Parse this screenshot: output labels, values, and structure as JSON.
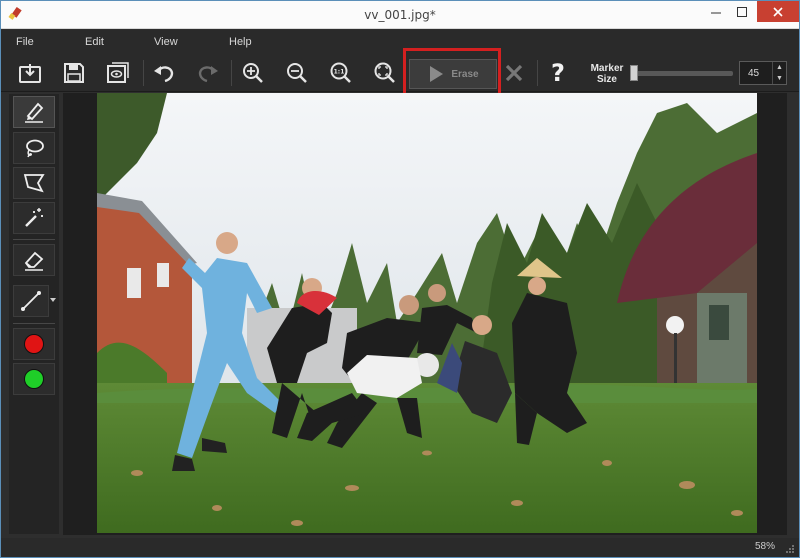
{
  "window": {
    "title": "vv_001.jpg*"
  },
  "menu": {
    "items": [
      "File",
      "Edit",
      "View",
      "Help"
    ]
  },
  "toolbar": {
    "buttons": [
      "open-icon",
      "save-icon",
      "save-copy-icon",
      "undo-icon",
      "redo-icon",
      "zoom-in-icon",
      "zoom-out-icon",
      "zoom-actual-size-icon",
      "zoom-fit-icon"
    ],
    "erase_label": "Erase",
    "help_label": "?",
    "marker_label_line1": "Marker",
    "marker_label_line2": "Size",
    "marker_size": "45",
    "marker_size_level": 0.05
  },
  "side_tools": [
    "pencil-marker-icon",
    "lasso-icon",
    "polygon-lasso-icon",
    "magic-wand-icon",
    "eraser-icon",
    "line-icon"
  ],
  "colors": {
    "red": "#e01414",
    "green": "#1fce28",
    "highlight": "#d42020"
  },
  "status": {
    "zoom": "58%"
  }
}
